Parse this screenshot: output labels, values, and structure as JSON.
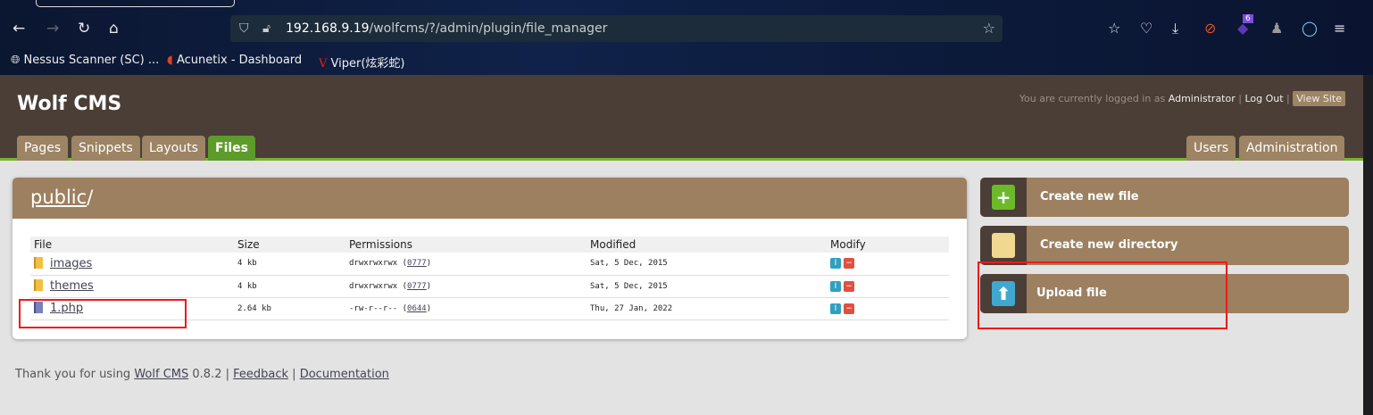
{
  "browser": {
    "url_host": "192.168.9.19",
    "url_path": "/wolfcms/?/admin/plugin/file_manager",
    "bookmarks": [
      "Nessus Scanner (SC) ...",
      "Acunetix - Dashboard",
      "Viper(炫彩蛇)"
    ],
    "extension_badge": "6"
  },
  "header": {
    "title": "Wolf CMS",
    "login_prefix": "You are currently logged in as",
    "user": "Administrator",
    "logout": "Log Out",
    "view_site": "View Site",
    "tabs": [
      "Pages",
      "Snippets",
      "Layouts",
      "Files"
    ],
    "right_tabs": [
      "Users",
      "Administration"
    ],
    "active_tab": "Files"
  },
  "panel": {
    "folder": "public",
    "slash": "/",
    "columns": [
      "File",
      "Size",
      "Permissions",
      "Modified",
      "Modify"
    ],
    "rows": [
      {
        "name": "images",
        "size": "4 kb",
        "perm": "drwxrwxrwx",
        "octal": "0777",
        "modified": "Sat, 5 Dec, 2015"
      },
      {
        "name": "themes",
        "size": "4 kb",
        "perm": "drwxrwxrwx",
        "octal": "0777",
        "modified": "Sat, 5 Dec, 2015"
      },
      {
        "name": "1.php",
        "size": "2.64 kb",
        "perm": "-rw-r--r--",
        "octal": "0644",
        "modified": "Thu, 27 Jan, 2022"
      }
    ]
  },
  "actions": [
    "Create new file",
    "Create new directory",
    "Upload file"
  ],
  "footer": {
    "prefix": "Thank you for using",
    "cms": "Wolf CMS",
    "version": "0.8.2",
    "feedback": "Feedback",
    "docs": "Documentation"
  }
}
